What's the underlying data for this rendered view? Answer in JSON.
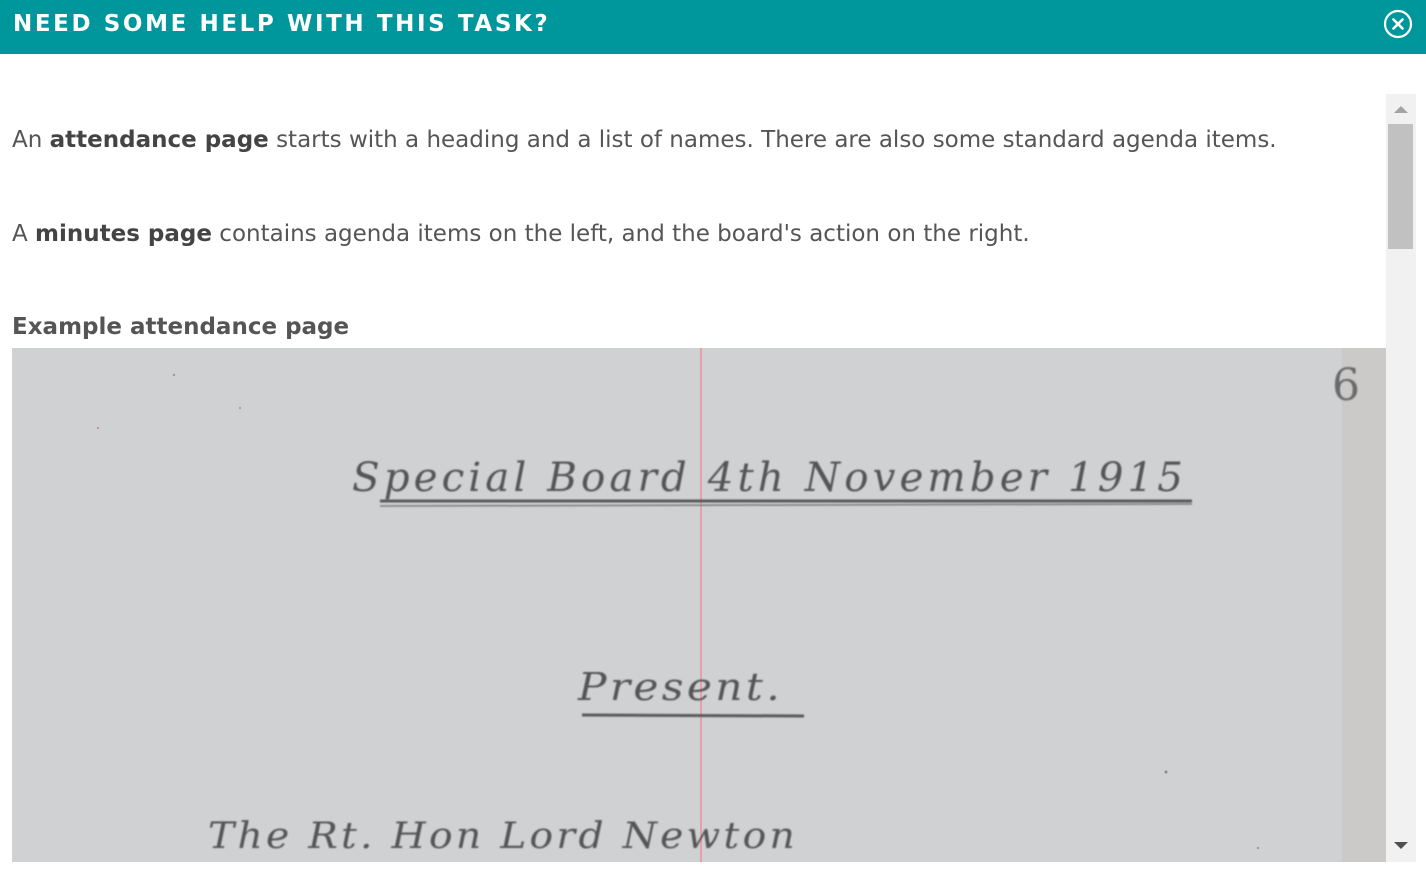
{
  "dialog": {
    "title": "NEED SOME HELP WITH THIS TASK?",
    "close_icon": "close-circle-icon"
  },
  "help": {
    "p1": {
      "prefix": "An ",
      "bold": "attendance page",
      "suffix": " starts with a heading and a list of names. There are also some standard agenda items."
    },
    "p2": {
      "prefix": "A ",
      "bold": "minutes page",
      "suffix": " contains agenda items on the left, and the board's action on the right."
    },
    "example_title": "Example attendance page"
  },
  "example_image": {
    "page_number": "6",
    "heading": "Special Board 4th November 1915",
    "present": "Present.",
    "first_name": "The Rt. Hon Lord Newton"
  },
  "colors": {
    "header_bg": "#00979c",
    "paper": "#cfd1d3",
    "margin_line": "#e8a0a8"
  }
}
